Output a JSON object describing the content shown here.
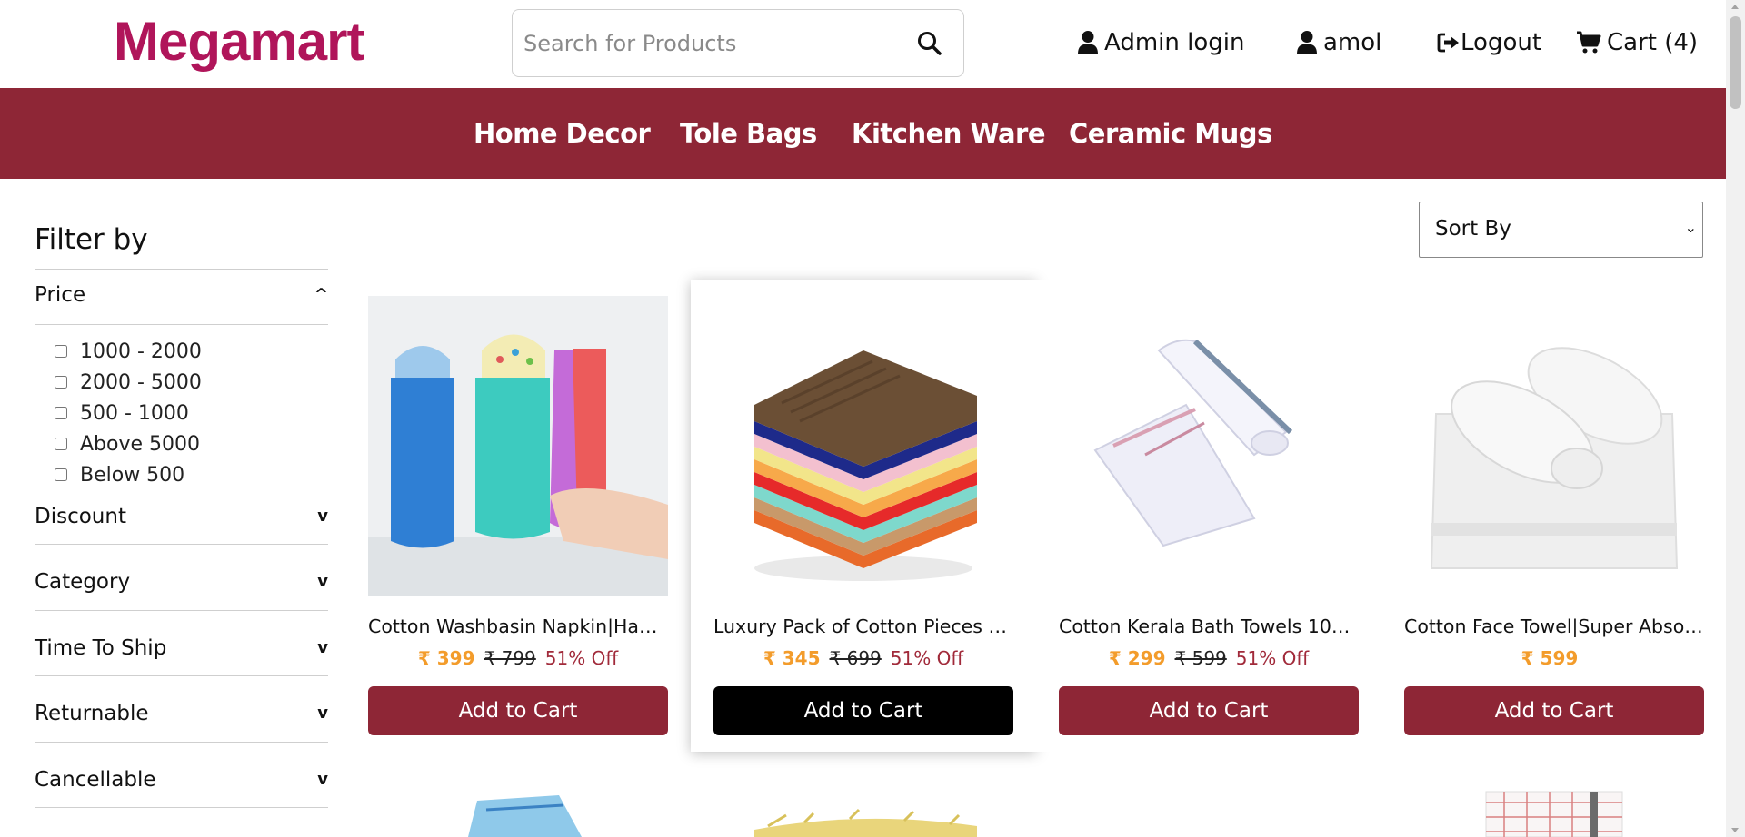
{
  "header": {
    "brand": "Megamart",
    "search_placeholder": "Search for Products",
    "admin_login": "Admin login",
    "user": "amol",
    "logout": "Logout",
    "cart": "Cart (4)"
  },
  "categories": [
    "Home Decor",
    "Tole Bags",
    "Kitchen Ware",
    "Ceramic Mugs"
  ],
  "filters": {
    "title": "Filter by",
    "price": {
      "label": "Price",
      "arrow": "^",
      "options": [
        "1000 - 2000",
        "2000 - 5000",
        "500 - 1000",
        "Above 5000",
        "Below 500"
      ]
    },
    "sections": [
      {
        "label": "Discount",
        "arrow": "v"
      },
      {
        "label": "Category",
        "arrow": "v"
      },
      {
        "label": "Time To Ship",
        "arrow": "v"
      },
      {
        "label": "Returnable",
        "arrow": "v"
      },
      {
        "label": "Cancellable",
        "arrow": "v"
      }
    ]
  },
  "sort": {
    "label": "Sort By"
  },
  "products": [
    {
      "name": "Cotton Washbasin Napkin|Han...",
      "price": "₹ 399",
      "mrp": "₹ 799",
      "off": "51% Off",
      "button": "Add to Cart"
    },
    {
      "name": "Luxury Pack of Cotton Pieces Fa...",
      "price": "₹ 345",
      "mrp": "₹ 699",
      "off": "51% Off",
      "button": "Add to Cart"
    },
    {
      "name": "Cotton Kerala Bath Towels 100 ...",
      "price": "₹ 299",
      "mrp": "₹ 599",
      "off": "51% Off",
      "button": "Add to Cart"
    },
    {
      "name": "Cotton Face Towel|Super Absor...",
      "price": "₹ 599",
      "mrp": "",
      "off": "",
      "button": "Add to Cart"
    }
  ],
  "colors": {
    "brand": "#b0155a",
    "category_bar": "#8e2636",
    "button": "#8e2636",
    "button_hover": "#000000",
    "price": "#f39c2b",
    "discount": "#a12a3a"
  },
  "icons": {
    "search": "search-icon",
    "user": "user-icon",
    "logout": "logout-icon",
    "cart": "cart-icon"
  }
}
